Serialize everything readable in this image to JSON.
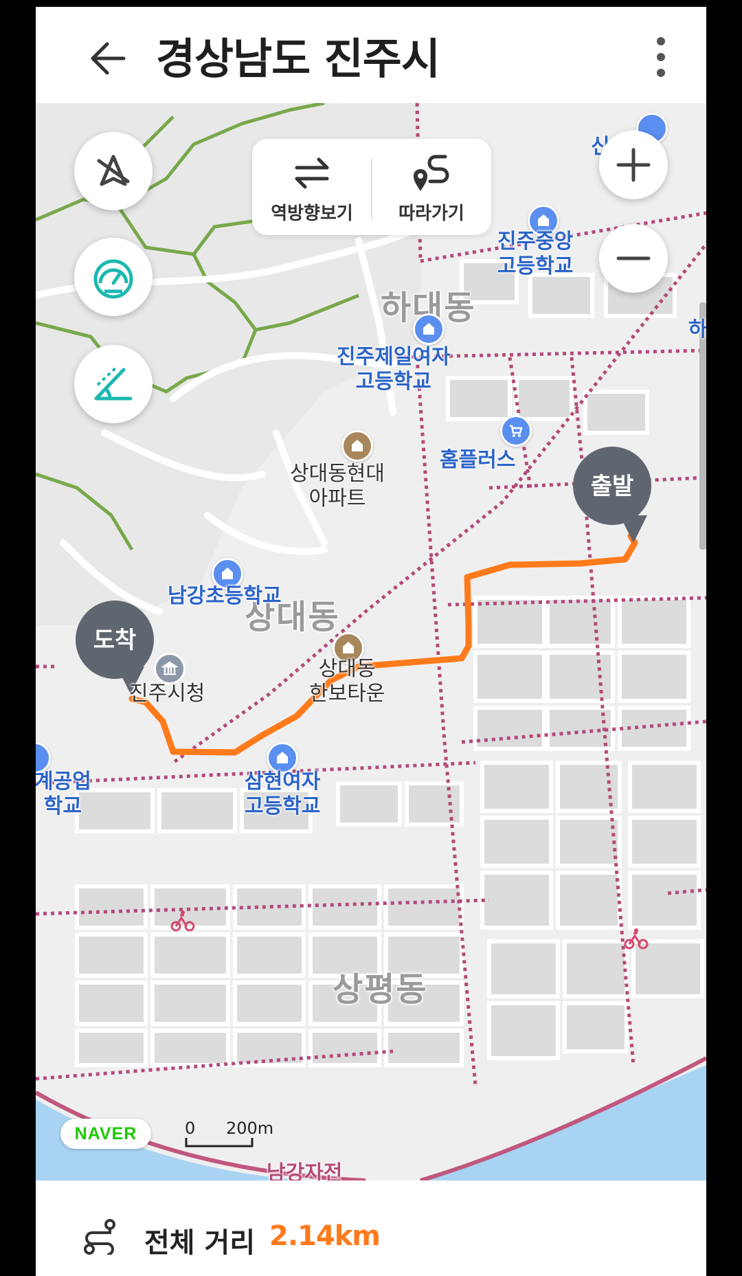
{
  "header": {
    "title": "경상남도 진주시"
  },
  "map_controls": {
    "reverse_label": "역방향보기",
    "follow_label": "따라가기"
  },
  "pois": {
    "jinju_jungang_school": "진주중앙\n고등학교",
    "jinju_jeil_girls_school": "진주제일여자\n고등학교",
    "homeplus": "홈플러스",
    "sangdae_hyundai_apt": "상대동현대\n아파트",
    "namgang_elementary": "남강초등학교",
    "city_hall": "진주시청",
    "sangdae_hanbo_town": "상대동\n한보타운",
    "samhyeon_girls_school": "삼현여자\n고등학교",
    "left_school_partial": "계공업\n학교",
    "top_right_school_partial": "신  학교",
    "right_edge_partial": "하"
  },
  "districts": {
    "hadae": "하대동",
    "sangdae": "상대동",
    "sangpyeong": "상평동"
  },
  "markers": {
    "start": "출발",
    "end": "도착"
  },
  "map_footer": {
    "brand": "NAVER",
    "scale_zero": "0",
    "scale_distance": "200m",
    "road_partial": "남강자전"
  },
  "summary": {
    "distance_label": "전체 거리",
    "distance_value": "2.14km"
  },
  "colors": {
    "route": "#ff7a1a",
    "bike_path": "#b44a78",
    "trail": "#78a84a",
    "river": "#a9d3f2",
    "marker": "#5f6670",
    "teal_icon": "#1bb8b0"
  }
}
